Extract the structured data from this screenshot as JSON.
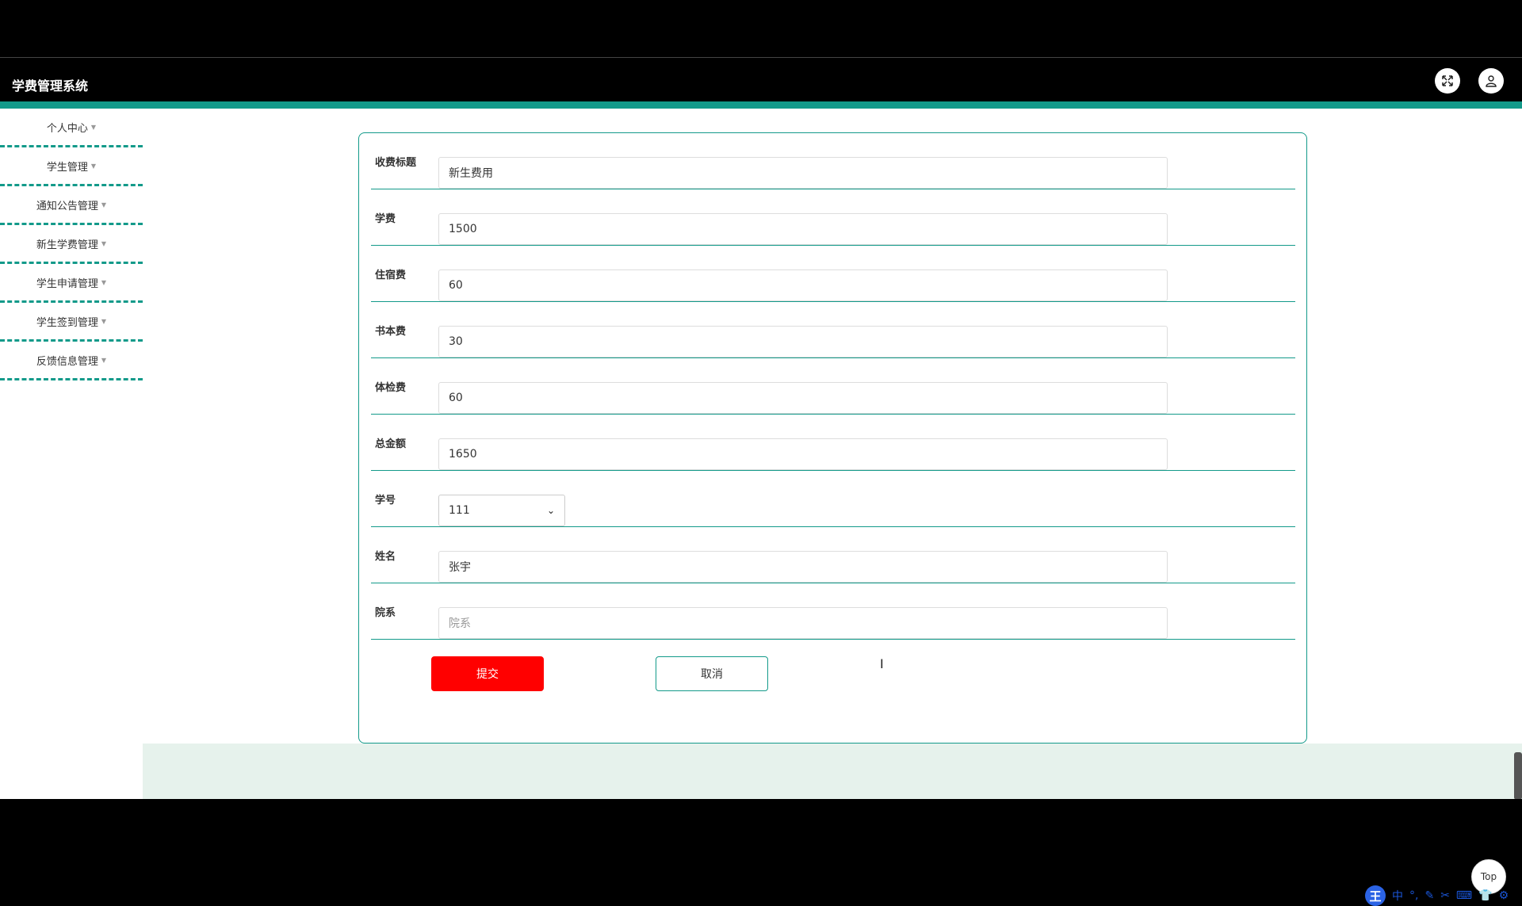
{
  "app": {
    "title": "学费管理系统"
  },
  "header": {
    "fullscreen_icon": "expand-arrows-icon",
    "user_icon": "user-icon"
  },
  "sidebar": {
    "items": [
      {
        "label": "个人中心"
      },
      {
        "label": "学生管理"
      },
      {
        "label": "通知公告管理"
      },
      {
        "label": "新生学费管理"
      },
      {
        "label": "学生申请管理"
      },
      {
        "label": "学生签到管理"
      },
      {
        "label": "反馈信息管理"
      }
    ]
  },
  "form": {
    "title_label": "收费标题",
    "title_value": "新生费用",
    "tuition_label": "学费",
    "tuition_value": "1500",
    "dorm_label": "住宿费",
    "dorm_value": "60",
    "books_label": "书本费",
    "books_value": "30",
    "exam_label": "体检费",
    "exam_value": "60",
    "total_label": "总金额",
    "total_value": "1650",
    "student_id_label": "学号",
    "student_id_value": "111",
    "name_label": "姓名",
    "name_value": "张宇",
    "dept_label": "院系",
    "dept_placeholder": "院系",
    "submit_label": "提交",
    "cancel_label": "取消"
  },
  "misc": {
    "top_label": "Top",
    "ime_logo": "王",
    "ime_mode": "中"
  },
  "colors": {
    "accent": "#139a8a",
    "submit": "#ff0000",
    "footer_bg": "#e6f2ec"
  }
}
